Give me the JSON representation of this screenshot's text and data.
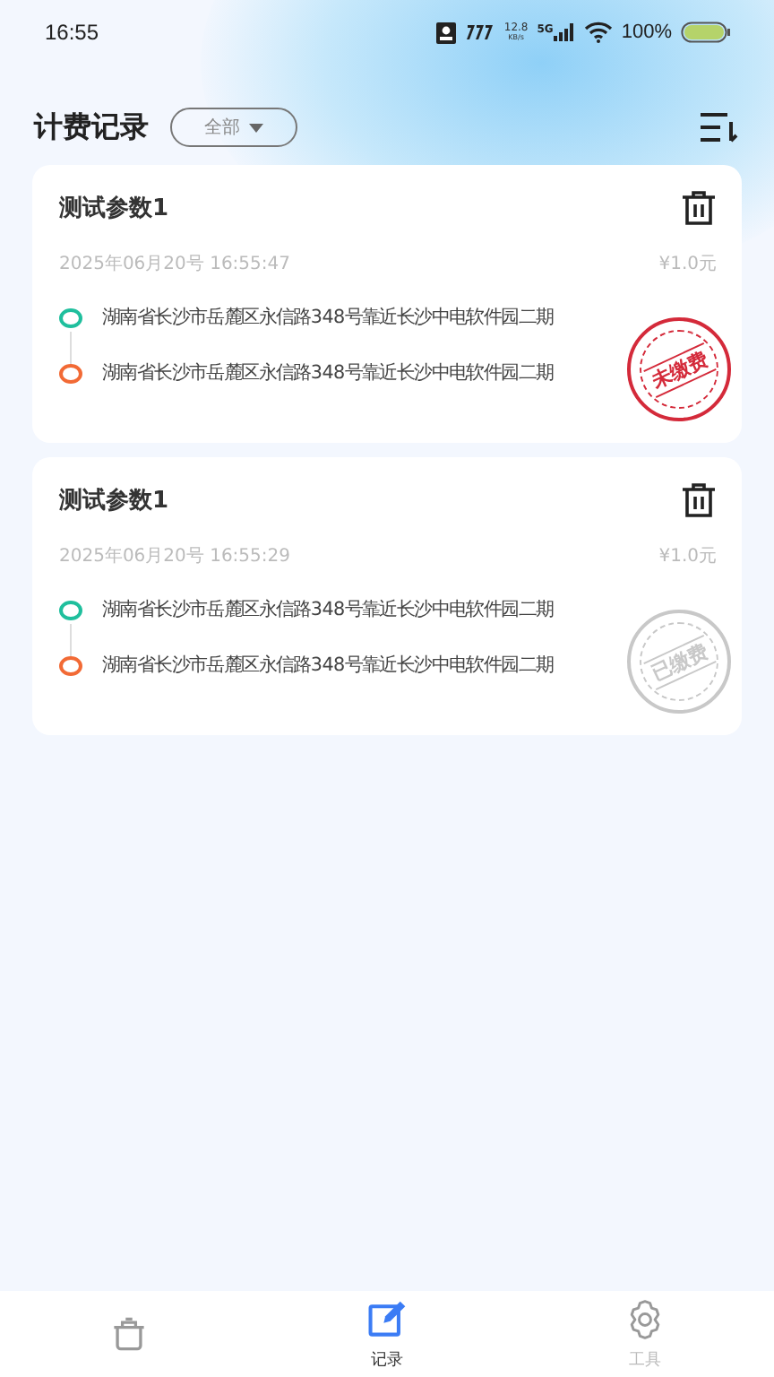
{
  "status_bar": {
    "time": "16:55",
    "net_speed": "12.8",
    "net_unit": "KB/s",
    "network": "5G",
    "battery": "100%"
  },
  "header": {
    "title": "计费记录",
    "filter": "全部"
  },
  "records": [
    {
      "title": "测试参数1",
      "time": "2025年06月20号 16:55:47",
      "price": "¥1.0元",
      "from": "湖南省长沙市岳麓区永信路348号靠近长沙中电软件园二期",
      "to": "湖南省长沙市岳麓区永信路348号靠近长沙中电软件园二期",
      "stamp": {
        "kind": "unpaid",
        "text": "未缴费"
      }
    },
    {
      "title": "测试参数1",
      "time": "2025年06月20号 16:55:29",
      "price": "¥1.0元",
      "from": "湖南省长沙市岳麓区永信路348号靠近长沙中电软件园二期",
      "to": "湖南省长沙市岳麓区永信路348号靠近长沙中电软件园二期",
      "stamp": {
        "kind": "paid",
        "text": "已缴费"
      }
    }
  ],
  "tabs": [
    {
      "kind": "pot",
      "selected": false
    },
    {
      "kind": "edit",
      "label": "记录",
      "selected": true
    },
    {
      "kind": "gear",
      "label": "工具",
      "selected": false
    }
  ]
}
